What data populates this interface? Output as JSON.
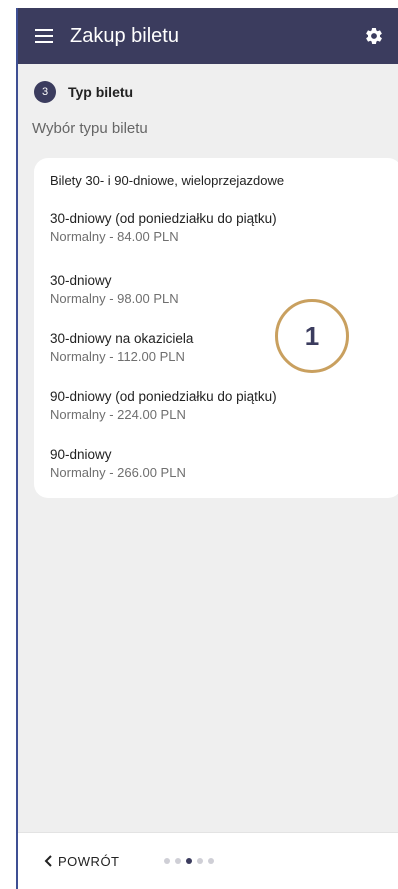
{
  "header": {
    "title": "Zakup biletu",
    "menu_icon": "menu-icon",
    "settings_icon": "gear-icon",
    "background": "#3b3c5e"
  },
  "step": {
    "number": "3",
    "title": "Typ biletu"
  },
  "section": {
    "subtitle": "Wybór typu biletu"
  },
  "card": {
    "heading": "Bilety 30- i 90-dniowe, wieloprzejazdowe",
    "tickets": [
      {
        "name": "30-dniowy (od poniedziałku do piątku)",
        "price": "Normalny - 84.00 PLN"
      },
      {
        "name": "30-dniowy",
        "price": "Normalny - 98.00 PLN"
      },
      {
        "name": "30-dniowy na okaziciela",
        "price": "Normalny - 112.00 PLN"
      },
      {
        "name": "90-dniowy (od poniedziałku do piątku)",
        "price": "Normalny - 224.00 PLN"
      },
      {
        "name": "90-dniowy",
        "price": "Normalny - 266.00 PLN"
      }
    ]
  },
  "annotation": {
    "number": "1",
    "color": "#c9a05f"
  },
  "footer": {
    "back_label": "POWRÓT",
    "back_icon": "chevron-left-icon",
    "pager": {
      "total": 5,
      "current": 3
    }
  }
}
